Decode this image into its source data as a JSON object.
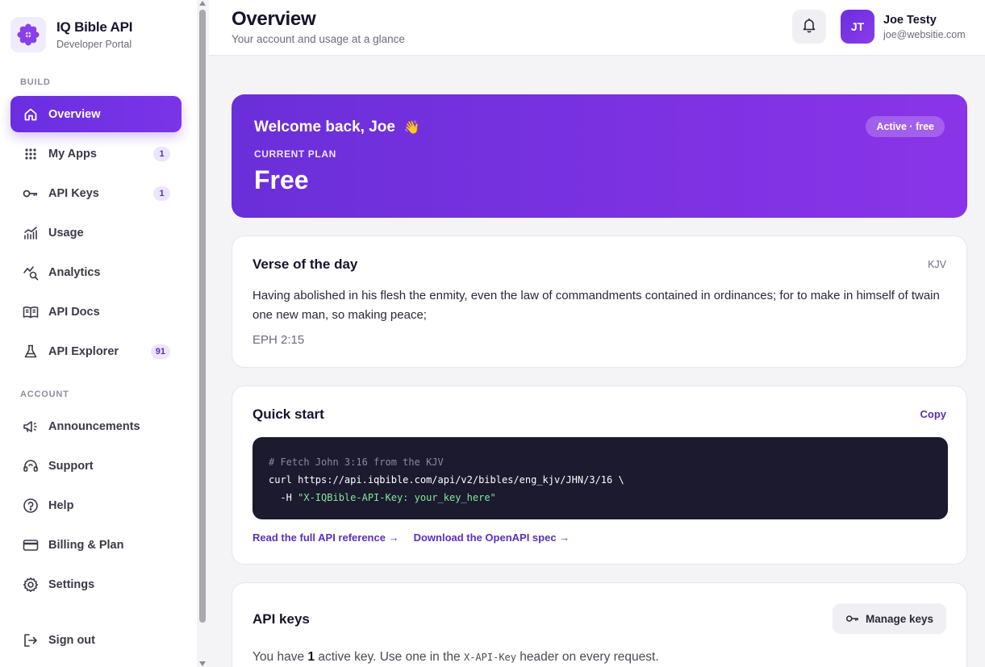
{
  "brand": {
    "name": "IQ Bible API",
    "subtitle": "Developer Portal"
  },
  "sidebar": {
    "build_label": "BUILD",
    "account_label": "ACCOUNT",
    "items": [
      {
        "label": "Overview",
        "icon": "home-icon",
        "active": true
      },
      {
        "label": "My Apps",
        "icon": "grid-icon",
        "badge": "1"
      },
      {
        "label": "API Keys",
        "icon": "key-icon",
        "badge": "1"
      },
      {
        "label": "Usage",
        "icon": "chart-icon"
      },
      {
        "label": "Analytics",
        "icon": "analytics-icon"
      },
      {
        "label": "API Docs",
        "icon": "book-icon"
      },
      {
        "label": "API Explorer",
        "icon": "flask-icon",
        "badge": "91"
      },
      {
        "label": "Announcements",
        "icon": "megaphone-icon"
      },
      {
        "label": "Support",
        "icon": "headset-icon"
      },
      {
        "label": "Help",
        "icon": "help-icon"
      },
      {
        "label": "Billing & Plan",
        "icon": "card-icon"
      },
      {
        "label": "Settings",
        "icon": "gear-icon"
      },
      {
        "label": "Sign out",
        "icon": "signout-icon"
      }
    ]
  },
  "header": {
    "title": "Overview",
    "subtitle": "Your account and usage at a glance",
    "user": {
      "initials": "JT",
      "name": "Joe Testy",
      "email": "joe@websitie.com"
    }
  },
  "welcome": {
    "title": "Welcome back, Joe",
    "emoji": "👋",
    "plan_label": "CURRENT PLAN",
    "plan_name": "Free",
    "status": "Active · free"
  },
  "verse": {
    "title": "Verse of the day",
    "version": "KJV",
    "text": "Having abolished in his flesh the enmity, even the law of commandments contained in ordinances; for to make in himself of twain one new man, so making peace;",
    "reference": "EPH 2:15"
  },
  "quickstart": {
    "title": "Quick start",
    "copy_label": "Copy",
    "code_comment": "# Fetch John 3:16 from the KJV",
    "code_line1": "curl https://api.iqbible.com/api/v2/bibles/eng_kjv/JHN/3/16 \\",
    "code_line2_prefix": "  -H ",
    "code_line2_string": "\"X-IQBible-API-Key: your_key_here\"",
    "link_reference": "Read the full API reference →",
    "link_openapi": "Download the OpenAPI spec →"
  },
  "api_keys": {
    "title": "API keys",
    "manage_label": "Manage keys",
    "text_prefix": "You have ",
    "count": "1",
    "text_middle": " active key. Use one in the ",
    "header_name": "X-API-Key",
    "text_suffix": " header on every request."
  },
  "colors": {
    "accent": "#6a2ee0",
    "accent_light": "#ece6fb",
    "code_bg": "#1b1a2e"
  }
}
